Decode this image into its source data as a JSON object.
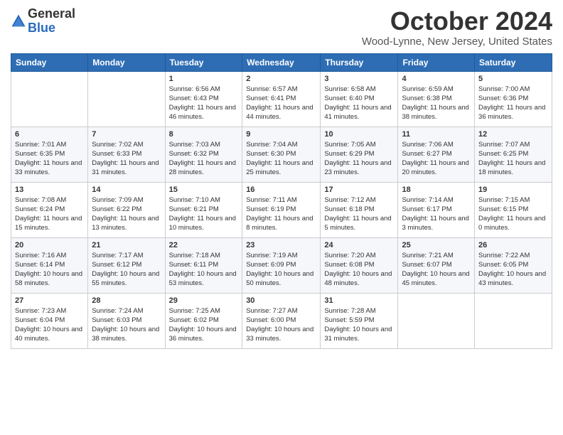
{
  "logo": {
    "general": "General",
    "blue": "Blue"
  },
  "header": {
    "title": "October 2024",
    "location": "Wood-Lynne, New Jersey, United States"
  },
  "days_of_week": [
    "Sunday",
    "Monday",
    "Tuesday",
    "Wednesday",
    "Thursday",
    "Friday",
    "Saturday"
  ],
  "weeks": [
    [
      {
        "day": "",
        "info": ""
      },
      {
        "day": "",
        "info": ""
      },
      {
        "day": "1",
        "info": "Sunrise: 6:56 AM\nSunset: 6:43 PM\nDaylight: 11 hours and 46 minutes."
      },
      {
        "day": "2",
        "info": "Sunrise: 6:57 AM\nSunset: 6:41 PM\nDaylight: 11 hours and 44 minutes."
      },
      {
        "day": "3",
        "info": "Sunrise: 6:58 AM\nSunset: 6:40 PM\nDaylight: 11 hours and 41 minutes."
      },
      {
        "day": "4",
        "info": "Sunrise: 6:59 AM\nSunset: 6:38 PM\nDaylight: 11 hours and 38 minutes."
      },
      {
        "day": "5",
        "info": "Sunrise: 7:00 AM\nSunset: 6:36 PM\nDaylight: 11 hours and 36 minutes."
      }
    ],
    [
      {
        "day": "6",
        "info": "Sunrise: 7:01 AM\nSunset: 6:35 PM\nDaylight: 11 hours and 33 minutes."
      },
      {
        "day": "7",
        "info": "Sunrise: 7:02 AM\nSunset: 6:33 PM\nDaylight: 11 hours and 31 minutes."
      },
      {
        "day": "8",
        "info": "Sunrise: 7:03 AM\nSunset: 6:32 PM\nDaylight: 11 hours and 28 minutes."
      },
      {
        "day": "9",
        "info": "Sunrise: 7:04 AM\nSunset: 6:30 PM\nDaylight: 11 hours and 25 minutes."
      },
      {
        "day": "10",
        "info": "Sunrise: 7:05 AM\nSunset: 6:29 PM\nDaylight: 11 hours and 23 minutes."
      },
      {
        "day": "11",
        "info": "Sunrise: 7:06 AM\nSunset: 6:27 PM\nDaylight: 11 hours and 20 minutes."
      },
      {
        "day": "12",
        "info": "Sunrise: 7:07 AM\nSunset: 6:25 PM\nDaylight: 11 hours and 18 minutes."
      }
    ],
    [
      {
        "day": "13",
        "info": "Sunrise: 7:08 AM\nSunset: 6:24 PM\nDaylight: 11 hours and 15 minutes."
      },
      {
        "day": "14",
        "info": "Sunrise: 7:09 AM\nSunset: 6:22 PM\nDaylight: 11 hours and 13 minutes."
      },
      {
        "day": "15",
        "info": "Sunrise: 7:10 AM\nSunset: 6:21 PM\nDaylight: 11 hours and 10 minutes."
      },
      {
        "day": "16",
        "info": "Sunrise: 7:11 AM\nSunset: 6:19 PM\nDaylight: 11 hours and 8 minutes."
      },
      {
        "day": "17",
        "info": "Sunrise: 7:12 AM\nSunset: 6:18 PM\nDaylight: 11 hours and 5 minutes."
      },
      {
        "day": "18",
        "info": "Sunrise: 7:14 AM\nSunset: 6:17 PM\nDaylight: 11 hours and 3 minutes."
      },
      {
        "day": "19",
        "info": "Sunrise: 7:15 AM\nSunset: 6:15 PM\nDaylight: 11 hours and 0 minutes."
      }
    ],
    [
      {
        "day": "20",
        "info": "Sunrise: 7:16 AM\nSunset: 6:14 PM\nDaylight: 10 hours and 58 minutes."
      },
      {
        "day": "21",
        "info": "Sunrise: 7:17 AM\nSunset: 6:12 PM\nDaylight: 10 hours and 55 minutes."
      },
      {
        "day": "22",
        "info": "Sunrise: 7:18 AM\nSunset: 6:11 PM\nDaylight: 10 hours and 53 minutes."
      },
      {
        "day": "23",
        "info": "Sunrise: 7:19 AM\nSunset: 6:09 PM\nDaylight: 10 hours and 50 minutes."
      },
      {
        "day": "24",
        "info": "Sunrise: 7:20 AM\nSunset: 6:08 PM\nDaylight: 10 hours and 48 minutes."
      },
      {
        "day": "25",
        "info": "Sunrise: 7:21 AM\nSunset: 6:07 PM\nDaylight: 10 hours and 45 minutes."
      },
      {
        "day": "26",
        "info": "Sunrise: 7:22 AM\nSunset: 6:05 PM\nDaylight: 10 hours and 43 minutes."
      }
    ],
    [
      {
        "day": "27",
        "info": "Sunrise: 7:23 AM\nSunset: 6:04 PM\nDaylight: 10 hours and 40 minutes."
      },
      {
        "day": "28",
        "info": "Sunrise: 7:24 AM\nSunset: 6:03 PM\nDaylight: 10 hours and 38 minutes."
      },
      {
        "day": "29",
        "info": "Sunrise: 7:25 AM\nSunset: 6:02 PM\nDaylight: 10 hours and 36 minutes."
      },
      {
        "day": "30",
        "info": "Sunrise: 7:27 AM\nSunset: 6:00 PM\nDaylight: 10 hours and 33 minutes."
      },
      {
        "day": "31",
        "info": "Sunrise: 7:28 AM\nSunset: 5:59 PM\nDaylight: 10 hours and 31 minutes."
      },
      {
        "day": "",
        "info": ""
      },
      {
        "day": "",
        "info": ""
      }
    ]
  ]
}
